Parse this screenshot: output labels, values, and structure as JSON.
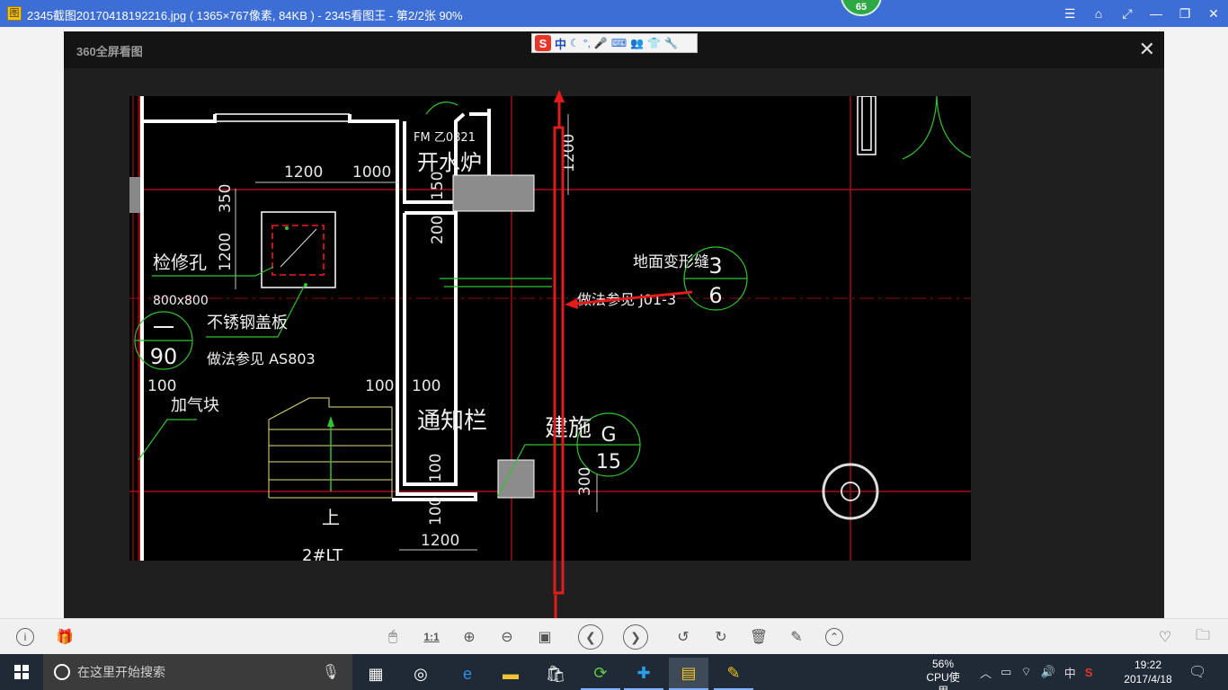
{
  "window": {
    "title": "2345截图20170418192216.jpg ( 1365×767像素, 84KB ) - 2345看图王 - 第2/2张 90%",
    "app_icon": "图",
    "badge": "65"
  },
  "viewer": {
    "brand": "360全屏看图",
    "close_glyph": "✕"
  },
  "ime": {
    "logo": "S",
    "mode": "中"
  },
  "drawing": {
    "dims": [
      "1200",
      "1000",
      "350",
      "1200",
      "150",
      "200",
      "1200",
      "100",
      "100",
      "100",
      "100",
      "100",
      "300",
      "1200",
      "800x800"
    ],
    "labels": {
      "door": "FM 乙0821",
      "room1": "开水炉",
      "hatch": "检修孔",
      "size": "800x800",
      "cover": "不锈钢盖板",
      "cover_ref": "做法参见 AS803",
      "block": "加气块",
      "notice": "通知栏",
      "joint": "地面变形缝",
      "joint_ref": "做法参见 J01-3",
      "jianshi": "建施",
      "stair_up": "上",
      "stair_name": "2#LT"
    },
    "callouts": [
      {
        "top": "一",
        "bottom": "90"
      },
      {
        "top": "3",
        "bottom": "6"
      },
      {
        "top": "G",
        "bottom": "15"
      }
    ]
  },
  "toolbar": {
    "info": "i",
    "ratio": "1:1"
  },
  "taskbar": {
    "search_placeholder": "在这里开始搜索",
    "cpu_percent": "56%",
    "cpu_label": "CPU使用",
    "ime": "中",
    "time": "19:22",
    "date": "2017/4/18"
  }
}
